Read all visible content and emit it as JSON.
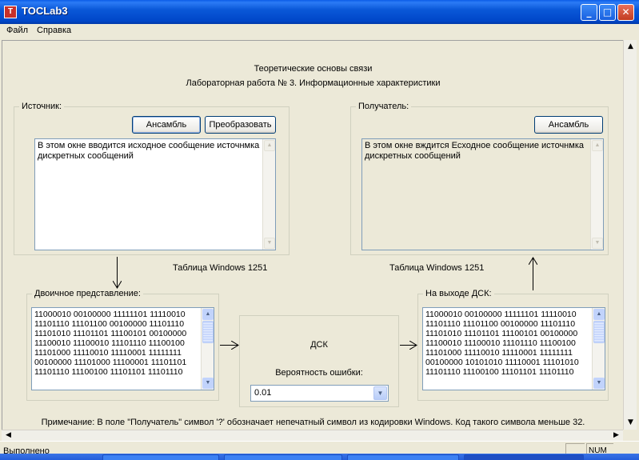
{
  "window": {
    "title": "TOCLab3",
    "app_icon_glyph": "T",
    "controls": {
      "minimize": "_",
      "maximize": "□",
      "close": "✕"
    }
  },
  "menu": {
    "file": "Файл",
    "help": "Справка"
  },
  "header": {
    "line1": "Теоретические основы связи",
    "line2": "Лабораторная работа № 3. Информационные характеристики"
  },
  "source": {
    "label": "Источник:",
    "ensemble_button": "Ансамбль",
    "transform_button": "Преобразовать",
    "text": "В этом окне вводится исходное сообщение источнмка дискретных сообщений"
  },
  "receiver": {
    "label": "Получатель:",
    "ensemble_button": "Ансамбль",
    "text": "В этом окне вждится Есходное сообщение источнмка  дискретных сообщений"
  },
  "encoding_left": "Таблица Windows 1251",
  "encoding_right": "Таблица Windows 1251",
  "binary": {
    "label": "Двоичное представление:",
    "text": "11000010 00100000 11111101 11110010 11101110 11101100 00100000 11101110 11101010 11101101 11100101 00100000 11100010 11100010 11101110 11100100 11101000 11110010 11110001 11111111 00100000 11101000 11100001 11101101 11101110 11100100 11101101 11101110"
  },
  "dsk": {
    "title": "ДСК",
    "error_prob_label": "Вероятность ошибки:",
    "error_prob_value": "0.01"
  },
  "output": {
    "label": "На выходе ДСК:",
    "text": "11000010 00100000 11111101 11110010 11101110 11101100 00100000 11101110 11101010 11101101 11100101 00100000 11100010 11100010 11101110 11100100 11101000 11110010 11110001 11111111 00100000 10101010 11110001 11101010 11101110 11100100 11101101 11101110"
  },
  "note": "Примечание: В поле \"Получатель\" символ '?' обозначает непечатный символ из кодировки Windows. Код такого символа меньше 32.",
  "status": {
    "text": "Выполнено",
    "num": "NUM"
  },
  "icons": {
    "scroll_up": "▲",
    "scroll_down": "▼",
    "scroll_left": "◀",
    "scroll_right": "▶",
    "dropdown": "▼"
  }
}
